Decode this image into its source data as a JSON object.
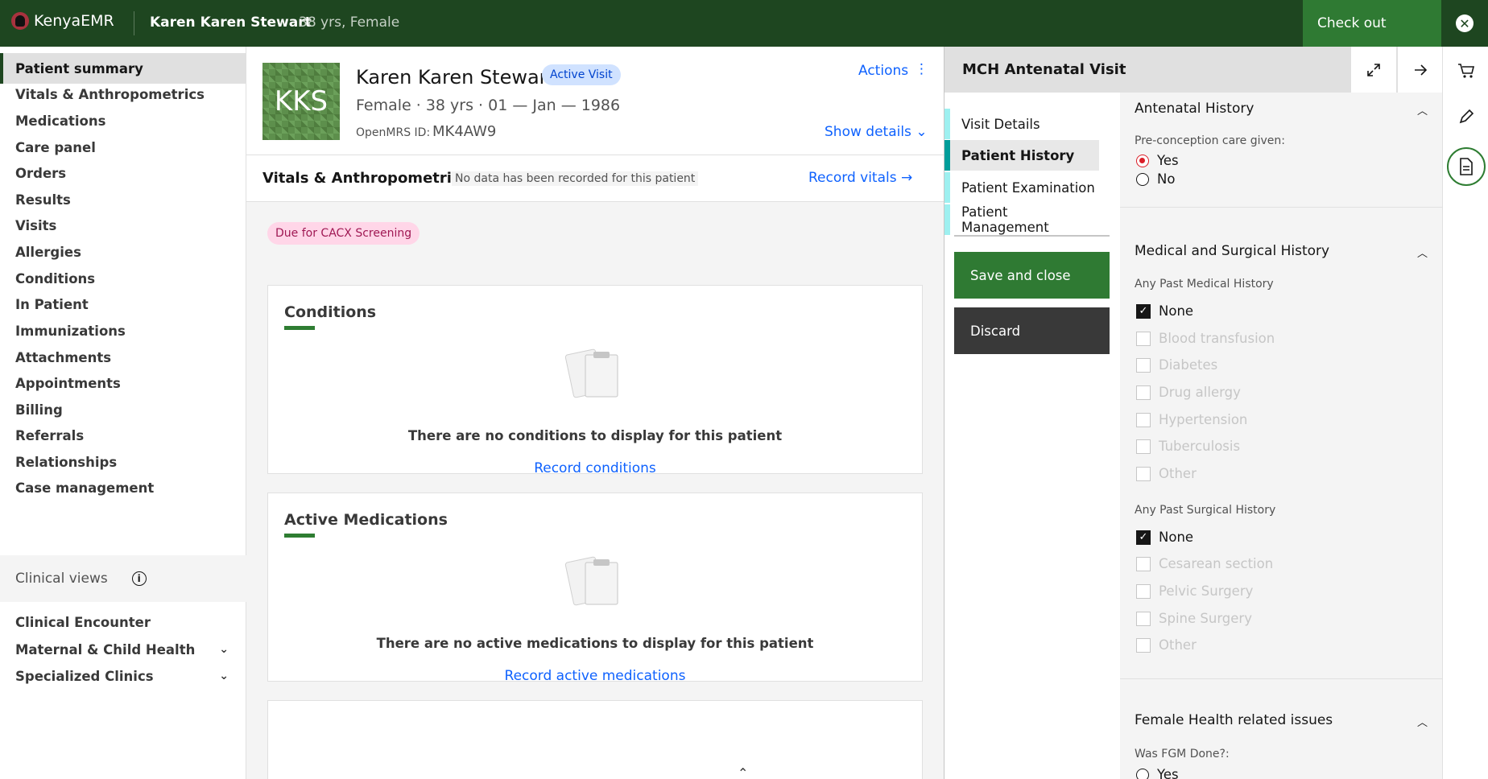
{
  "topbar": {
    "app_name": "KenyaEMR",
    "patient_name": "Karen Karen Stewart",
    "patient_age_gender": "38 yrs, Female",
    "checkout_label": "Check out",
    "close_symbol": "✕"
  },
  "nav": {
    "items": [
      "Patient summary",
      "Vitals & Anthropometrics",
      "Medications",
      "Care panel",
      "Orders",
      "Results",
      "Visits",
      "Allergies",
      "Conditions",
      "In Patient",
      "Immunizations",
      "Attachments",
      "Appointments",
      "Billing",
      "Referrals",
      "Relationships",
      "Case management"
    ],
    "clinical_views_label": "Clinical views",
    "clinical_items": [
      "Clinical Encounter",
      "Maternal & Child Health",
      "Specialized Clinics"
    ]
  },
  "banner": {
    "initials": "KKS",
    "name": "Karen Karen Stewart",
    "active_visit": "Active Visit",
    "demographics": "Female  ·  38 yrs  ·  01 — Jan — 1986",
    "openmrs_label": "OpenMRS ID:",
    "openmrs_id": "MK4AW9",
    "actions_label": "Actions",
    "actions_dots": "⋮",
    "show_details": "Show details ⌄"
  },
  "vitals": {
    "title": "Vitals & Anthropometrics",
    "nodata": "No data has been recorded for this patient",
    "record": "Record vitals →"
  },
  "cacx_tag": "Due for CACX Screening",
  "conditions": {
    "title": "Conditions",
    "message": "There are no conditions to display for this patient",
    "link": "Record conditions"
  },
  "medications": {
    "title": "Active Medications",
    "message": "There are no active medications to display for this patient",
    "link": "Record active medications"
  },
  "form": {
    "title": "MCH Antenatal Visit",
    "nav": [
      "Visit Details",
      "Patient History",
      "Patient Examination",
      "Patient Management"
    ],
    "save_label": "Save and close",
    "discard_label": "Discard",
    "sections": {
      "antenatal": {
        "title": "Antenatal History",
        "question": "Pre-conception care given:",
        "options": [
          "Yes",
          "No"
        ],
        "selected": "Yes"
      },
      "medsurg": {
        "title": "Medical and Surgical History",
        "medical_question": "Any Past Medical History",
        "medical_options": [
          "None",
          "Blood transfusion",
          "Diabetes",
          "Drug allergy",
          "Hypertension",
          "Tuberculosis",
          "Other"
        ],
        "surgical_question": "Any Past Surgical History",
        "surgical_options": [
          "None",
          "Cesarean section",
          "Pelvic Surgery",
          "Spine Surgery",
          "Other"
        ],
        "checked": "None"
      },
      "female_health": {
        "title": "Female Health related issues",
        "question": "Was FGM Done?:",
        "partial_option": "Yes"
      }
    }
  },
  "icons": {
    "cart": "cart-icon",
    "pen": "pen-icon",
    "form": "document-icon",
    "expand": "expand-icon",
    "arrow": "arrow-right-icon"
  }
}
